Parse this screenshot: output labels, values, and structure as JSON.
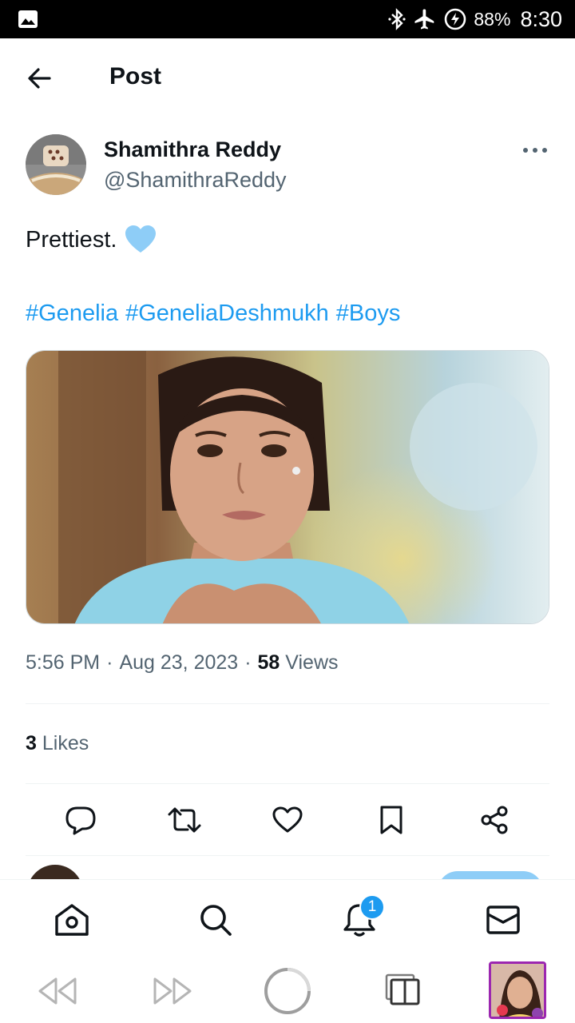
{
  "status_bar": {
    "battery": "88%",
    "time": "8:30"
  },
  "header": {
    "title": "Post"
  },
  "author": {
    "name": "Shamithra Reddy",
    "handle": "@ShamithraReddy"
  },
  "tweet": {
    "text": "Prettiest.",
    "emoji_icon": "blue-heart-icon",
    "hashtags": [
      "#Genelia",
      "#GeneliaDeshmukh",
      "#Boys"
    ]
  },
  "meta": {
    "time": "5:56 PM",
    "date": "Aug 23, 2023",
    "views_count": "58",
    "views_label": "Views"
  },
  "likes": {
    "count": "3",
    "label": "Likes"
  },
  "bottom_nav": {
    "notification_badge": "1"
  },
  "colors": {
    "accent": "#1d9bf0",
    "text": "#0f1419",
    "muted": "#536471"
  }
}
